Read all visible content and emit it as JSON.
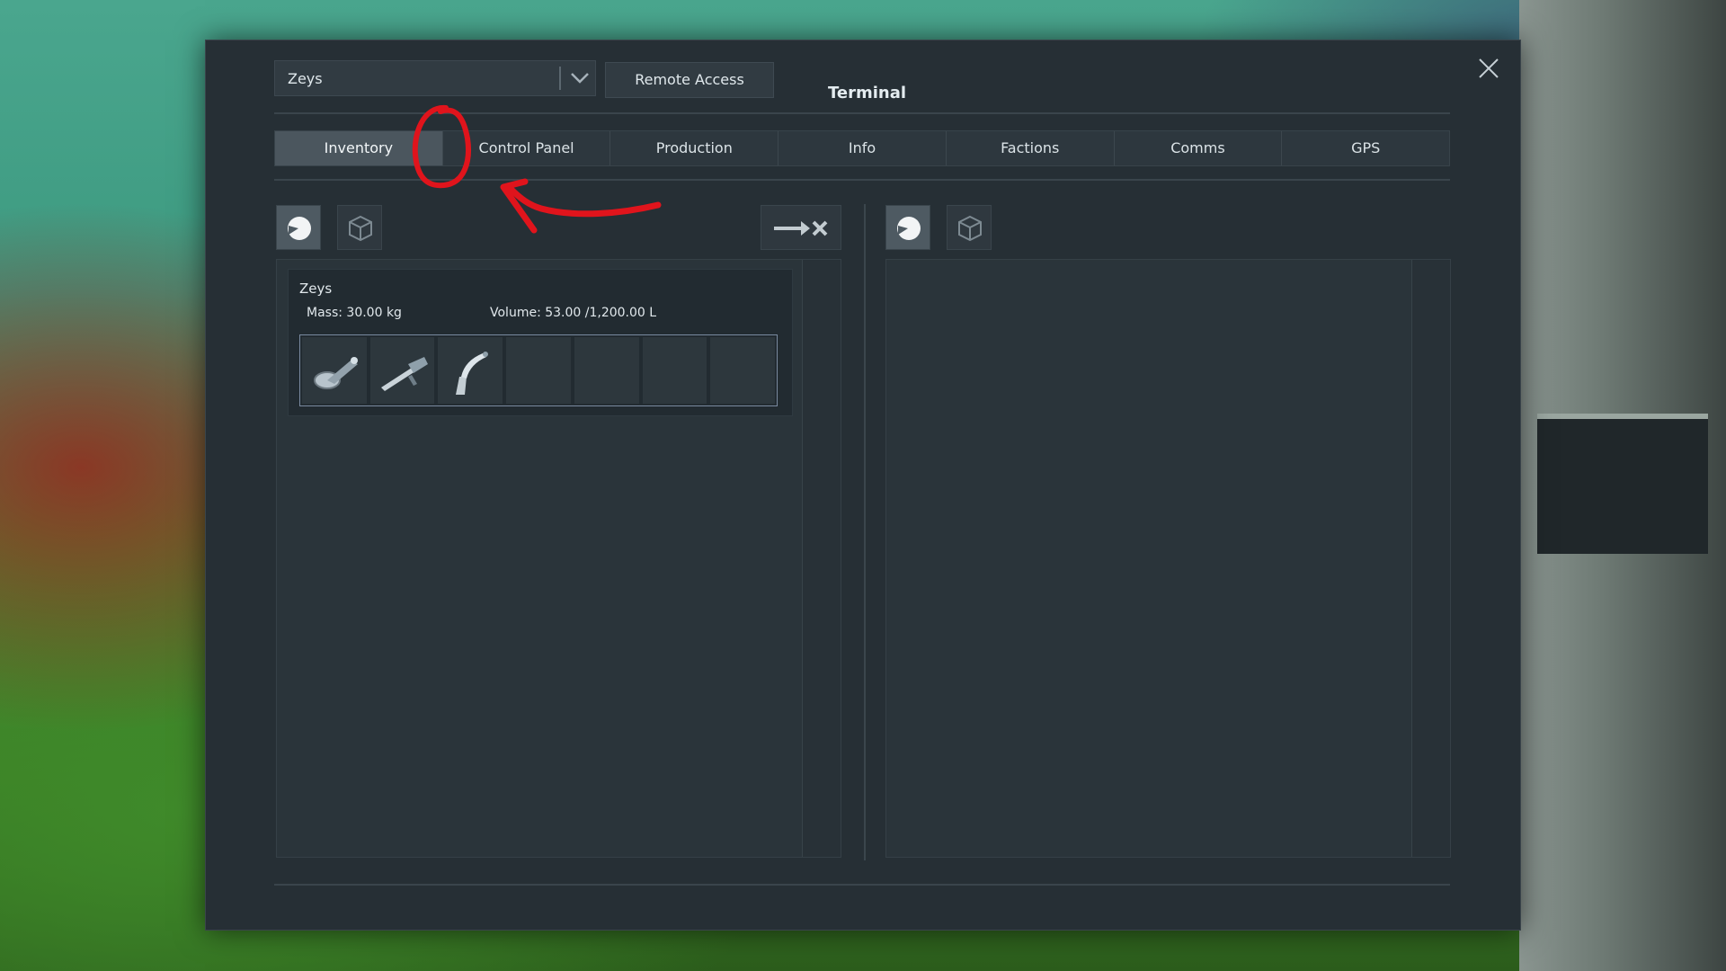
{
  "window": {
    "title": "Terminal",
    "close_icon": "close-icon"
  },
  "owner_select": {
    "value": "Zeys",
    "icon": "chevron-down-icon"
  },
  "remote_access_label": "Remote Access",
  "tabs": [
    {
      "label": "Inventory",
      "active": true
    },
    {
      "label": "Control Panel",
      "active": false
    },
    {
      "label": "Production",
      "active": false
    },
    {
      "label": "Info",
      "active": false
    },
    {
      "label": "Factions",
      "active": false
    },
    {
      "label": "Comms",
      "active": false
    },
    {
      "label": "GPS",
      "active": false
    }
  ],
  "left_panel": {
    "filters": [
      {
        "icon": "character-helmet-icon",
        "active": true
      },
      {
        "icon": "cargo-container-icon",
        "active": false
      }
    ],
    "transfer_icon": "transfer-disabled-icon",
    "inventory": {
      "name": "Zeys",
      "mass": "Mass: 30.00 kg",
      "volume": "Volume: 53.00 /1,200.00 L",
      "slots": [
        {
          "item_icon": "grinder-icon"
        },
        {
          "item_icon": "hand-drill-icon"
        },
        {
          "item_icon": "welder-icon"
        },
        {
          "item_icon": ""
        },
        {
          "item_icon": ""
        },
        {
          "item_icon": ""
        },
        {
          "item_icon": ""
        }
      ]
    }
  },
  "right_panel": {
    "filters": [
      {
        "icon": "character-helmet-icon",
        "active": true
      },
      {
        "icon": "cargo-container-icon",
        "active": false
      }
    ]
  },
  "colors": {
    "panel_bg": "#262f35",
    "tab_active": "#4b565e",
    "annotation_red": "#e0141c"
  }
}
